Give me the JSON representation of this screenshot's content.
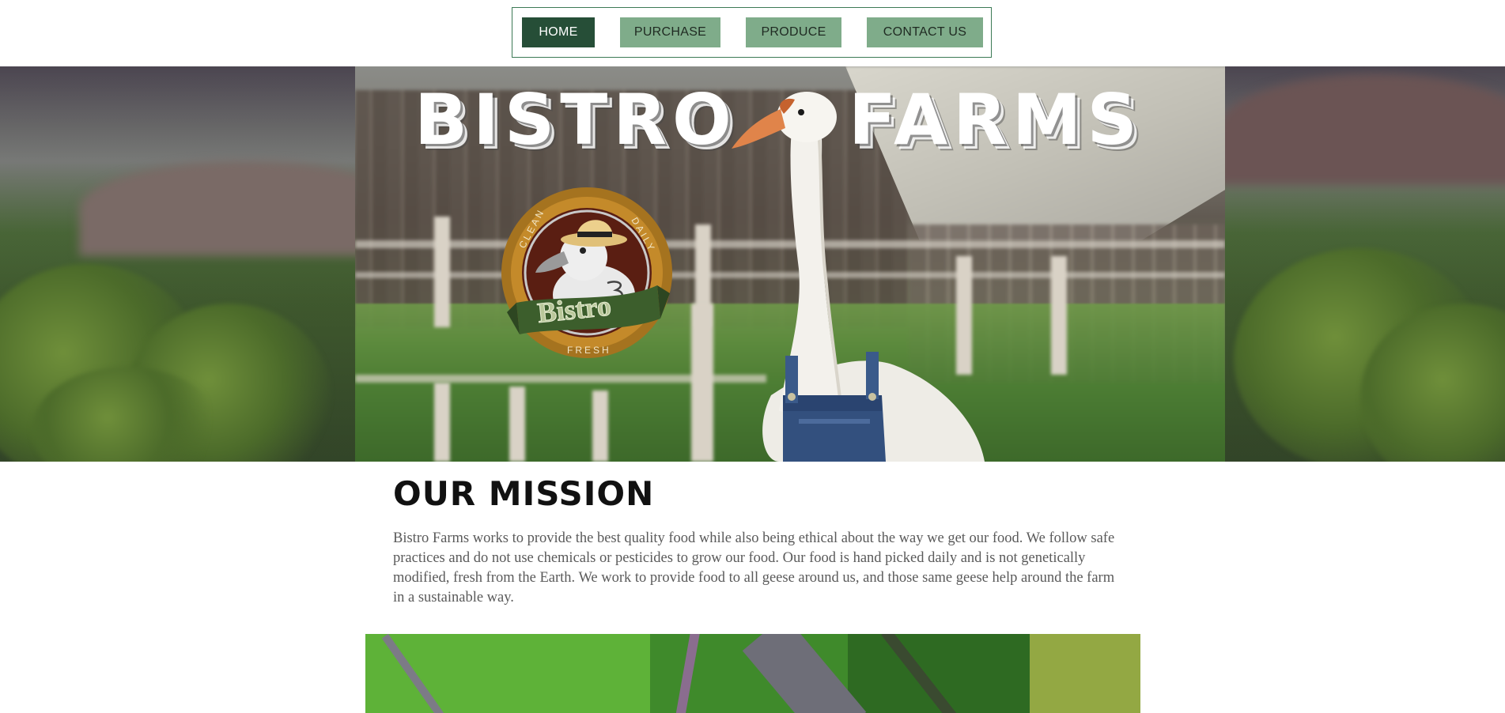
{
  "nav": {
    "items": [
      {
        "label": "HOME",
        "active": true
      },
      {
        "label": "PURCHASE",
        "active": false
      },
      {
        "label": "PRODUCE",
        "active": false
      },
      {
        "label": "CONTACT US",
        "active": false
      }
    ]
  },
  "hero": {
    "title_left": "BISTRO",
    "title_right": "FARMS"
  },
  "logo": {
    "ring_top_left": "CLEAN",
    "ring_top_right": "DAILY",
    "ring_bottom": "FRESH",
    "banner_text": "Bistro"
  },
  "mission": {
    "title": "OUR MISSION",
    "body": "Bistro Farms works to provide the best quality food while also being ethical about the way we get our food. We follow safe practices and do not use chemicals or pesticides to grow our food. Our food is hand picked daily and is not genetically modified, fresh from the Earth. We work to provide food to all geese around us, and those same geese help around the farm in a sustainable way."
  },
  "colors": {
    "nav_active": "#264e37",
    "nav_inactive": "#7fac8a",
    "nav_border": "#3c7a55"
  }
}
